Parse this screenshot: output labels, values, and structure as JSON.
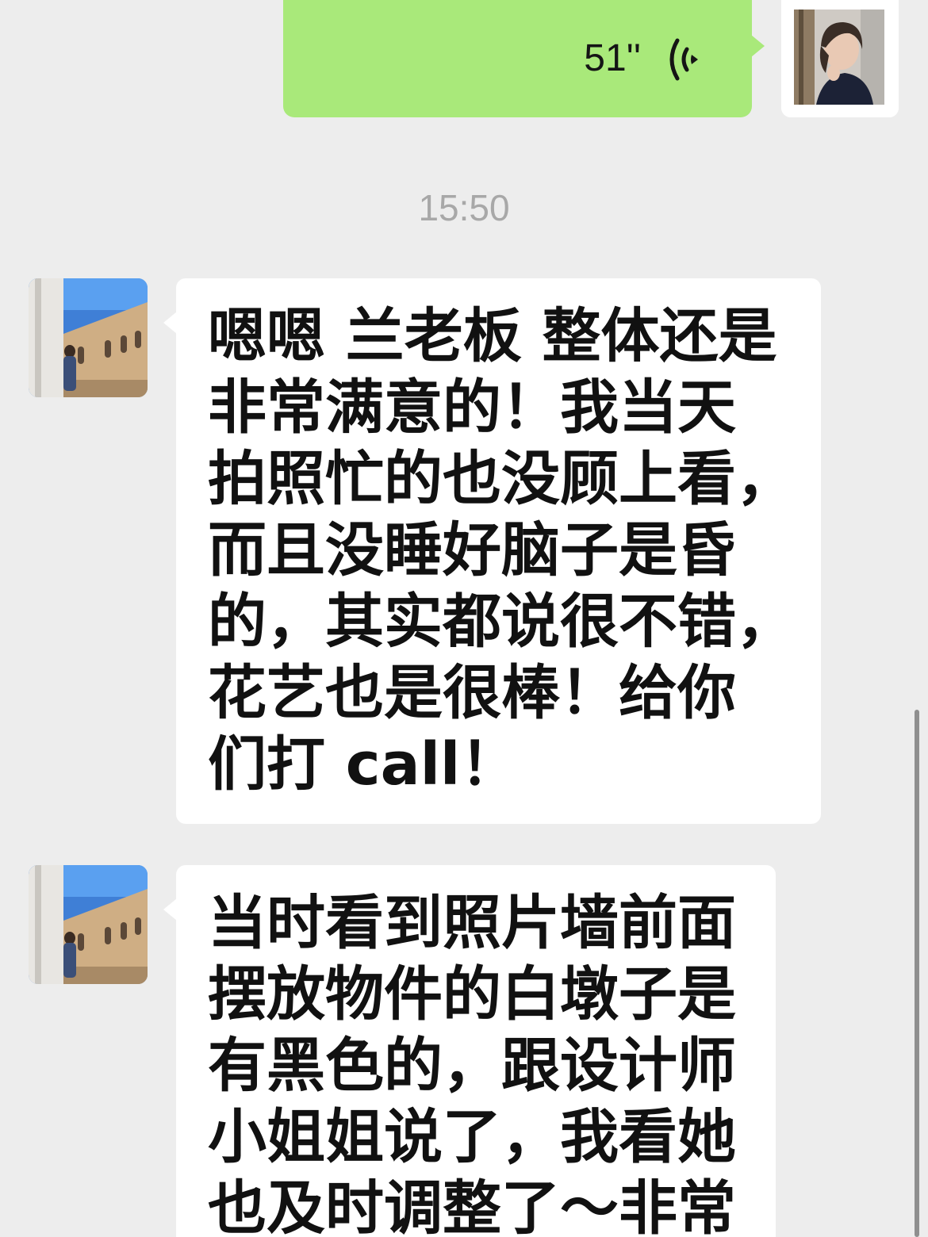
{
  "outgoing_voice": {
    "duration": "51''",
    "icon": "voice-wave-icon"
  },
  "timestamp": "15:50",
  "messages": [
    {
      "lines": [
        "嗯嗯 兰老板 整体还是",
        "非常满意的！我当天",
        "拍照忙的也没顾上看，",
        "而且没睡好脑子是昏",
        "的，其实都说很不错，",
        "花艺也是很棒！给你",
        "们打 call！"
      ]
    },
    {
      "lines": [
        "当时看到照片墙前面",
        "摆放物件的白墩子是",
        "有黑色的，跟设计师",
        "小姐姐说了，我看她",
        "也及时调整了～非常"
      ]
    }
  ],
  "colors": {
    "background": "#ededed",
    "outgoing_bubble": "#a9e97a",
    "incoming_bubble": "#ffffff",
    "timestamp_text": "#a8a8a8"
  }
}
